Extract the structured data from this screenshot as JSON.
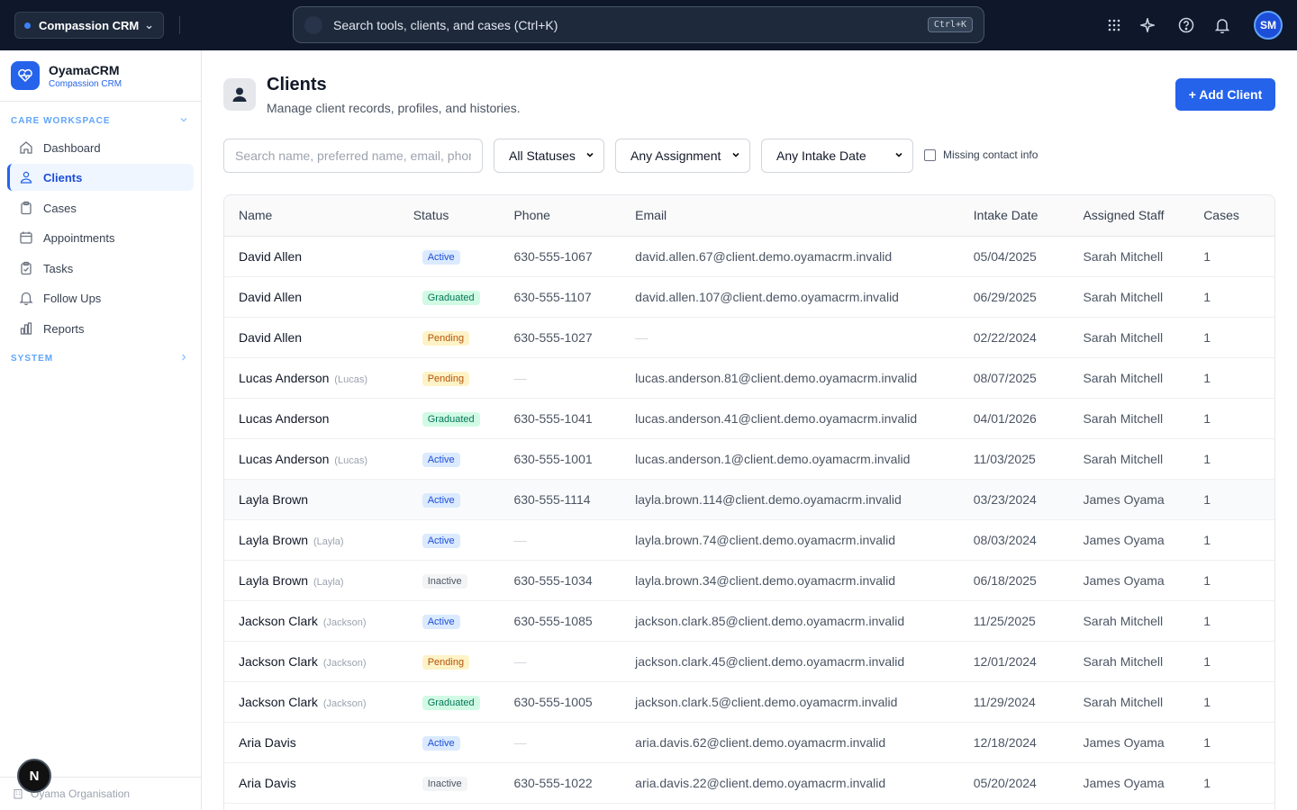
{
  "topbar": {
    "org_name": "Compassion CRM",
    "search_placeholder": "Search tools, clients, and cases (Ctrl+K)",
    "shortcut": "Ctrl+K",
    "avatar_initials": "SM"
  },
  "sidebar": {
    "brand_name": "OyamaCRM",
    "brand_sub": "Compassion CRM",
    "section_care": "CARE WORKSPACE",
    "section_system": "SYSTEM",
    "items": [
      {
        "label": "Dashboard",
        "icon": "home-icon"
      },
      {
        "label": "Clients",
        "icon": "users-icon",
        "active": true
      },
      {
        "label": "Cases",
        "icon": "clipboard-icon"
      },
      {
        "label": "Appointments",
        "icon": "calendar-icon"
      },
      {
        "label": "Tasks",
        "icon": "checklist-icon"
      },
      {
        "label": "Follow Ups",
        "icon": "bell-icon"
      },
      {
        "label": "Reports",
        "icon": "bar-chart-icon"
      }
    ],
    "footer": "Oyama Organisation",
    "n_badge": "N"
  },
  "page": {
    "title": "Clients",
    "subtitle": "Manage client records, profiles, and histories.",
    "add_button": "+ Add Client"
  },
  "filters": {
    "search_placeholder": "Search name, preferred name, email, phone",
    "status": "All Statuses",
    "assignment": "Any Assignment",
    "intake": "Any Intake Date",
    "missing_contact": "Missing contact info"
  },
  "table": {
    "headers": [
      "Name",
      "Status",
      "Phone",
      "Email",
      "Intake Date",
      "Assigned Staff",
      "Cases"
    ],
    "rows": [
      {
        "name": "David Allen",
        "preferred": "",
        "status": "Active",
        "phone": "630-555-1067",
        "email": "david.allen.67@client.demo.oyamacrm.invalid",
        "intake": "05/04/2025",
        "staff": "Sarah Mitchell",
        "cases": "1"
      },
      {
        "name": "David Allen",
        "preferred": "",
        "status": "Graduated",
        "phone": "630-555-1107",
        "email": "david.allen.107@client.demo.oyamacrm.invalid",
        "intake": "06/29/2025",
        "staff": "Sarah Mitchell",
        "cases": "1"
      },
      {
        "name": "David Allen",
        "preferred": "",
        "status": "Pending",
        "phone": "630-555-1027",
        "email": "—",
        "intake": "02/22/2024",
        "staff": "Sarah Mitchell",
        "cases": "1"
      },
      {
        "name": "Lucas Anderson",
        "preferred": "(Lucas)",
        "status": "Pending",
        "phone": "—",
        "email": "lucas.anderson.81@client.demo.oyamacrm.invalid",
        "intake": "08/07/2025",
        "staff": "Sarah Mitchell",
        "cases": "1"
      },
      {
        "name": "Lucas Anderson",
        "preferred": "",
        "status": "Graduated",
        "phone": "630-555-1041",
        "email": "lucas.anderson.41@client.demo.oyamacrm.invalid",
        "intake": "04/01/2026",
        "staff": "Sarah Mitchell",
        "cases": "1"
      },
      {
        "name": "Lucas Anderson",
        "preferred": "(Lucas)",
        "status": "Active",
        "phone": "630-555-1001",
        "email": "lucas.anderson.1@client.demo.oyamacrm.invalid",
        "intake": "11/03/2025",
        "staff": "Sarah Mitchell",
        "cases": "1"
      },
      {
        "name": "Layla Brown",
        "preferred": "",
        "status": "Active",
        "phone": "630-555-1114",
        "email": "layla.brown.114@client.demo.oyamacrm.invalid",
        "intake": "03/23/2024",
        "staff": "James Oyama",
        "cases": "1",
        "highlight": true
      },
      {
        "name": "Layla Brown",
        "preferred": "(Layla)",
        "status": "Active",
        "phone": "—",
        "email": "layla.brown.74@client.demo.oyamacrm.invalid",
        "intake": "08/03/2024",
        "staff": "James Oyama",
        "cases": "1"
      },
      {
        "name": "Layla Brown",
        "preferred": "(Layla)",
        "status": "Inactive",
        "phone": "630-555-1034",
        "email": "layla.brown.34@client.demo.oyamacrm.invalid",
        "intake": "06/18/2025",
        "staff": "James Oyama",
        "cases": "1"
      },
      {
        "name": "Jackson Clark",
        "preferred": "(Jackson)",
        "status": "Active",
        "phone": "630-555-1085",
        "email": "jackson.clark.85@client.demo.oyamacrm.invalid",
        "intake": "11/25/2025",
        "staff": "Sarah Mitchell",
        "cases": "1"
      },
      {
        "name": "Jackson Clark",
        "preferred": "(Jackson)",
        "status": "Pending",
        "phone": "—",
        "email": "jackson.clark.45@client.demo.oyamacrm.invalid",
        "intake": "12/01/2024",
        "staff": "Sarah Mitchell",
        "cases": "1"
      },
      {
        "name": "Jackson Clark",
        "preferred": "(Jackson)",
        "status": "Graduated",
        "phone": "630-555-1005",
        "email": "jackson.clark.5@client.demo.oyamacrm.invalid",
        "intake": "11/29/2024",
        "staff": "Sarah Mitchell",
        "cases": "1"
      },
      {
        "name": "Aria Davis",
        "preferred": "",
        "status": "Active",
        "phone": "—",
        "email": "aria.davis.62@client.demo.oyamacrm.invalid",
        "intake": "12/18/2024",
        "staff": "James Oyama",
        "cases": "1"
      },
      {
        "name": "Aria Davis",
        "preferred": "",
        "status": "Inactive",
        "phone": "630-555-1022",
        "email": "aria.davis.22@client.demo.oyamacrm.invalid",
        "intake": "05/20/2024",
        "staff": "James Oyama",
        "cases": "1"
      }
    ]
  }
}
